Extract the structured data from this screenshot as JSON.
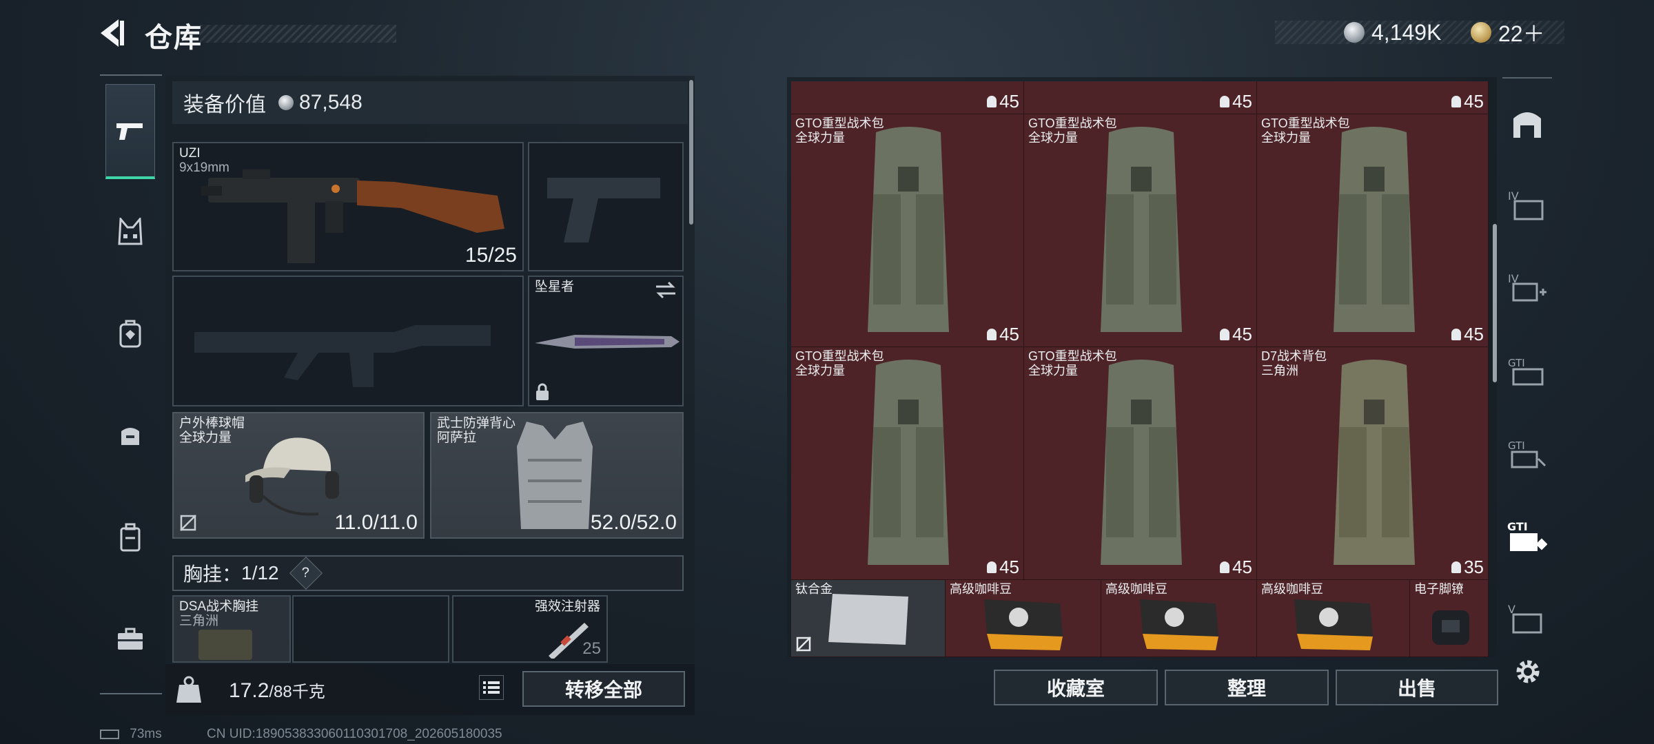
{
  "header": {
    "title": "仓库",
    "currency": [
      {
        "icon": "silver-coin-icon",
        "value": "4,149K"
      },
      {
        "icon": "gold-coin-icon",
        "value": "22＋"
      }
    ]
  },
  "loadout": {
    "value_label": "装备价值",
    "value": "87,548",
    "primary_weapon": {
      "name": "UZI",
      "ammo": "9x19mm",
      "count": "15/25"
    },
    "melee": {
      "name": "坠星者"
    },
    "helmet": {
      "name": "户外棒球帽",
      "brand": "全球力量",
      "durability": "11.0/11.0"
    },
    "armor": {
      "name": "武士防弹背心",
      "brand": "阿萨拉",
      "durability": "52.0/52.0"
    },
    "chest_rig_label": "胸挂：",
    "chest_rig_count": "1/12",
    "help": "?",
    "chest_rig": {
      "name": "DSA战术胸挂",
      "brand": "三角洲"
    },
    "injector": {
      "name": "强效注射器",
      "count": "25"
    },
    "weight": "17.2",
    "weight_max": "/88千克",
    "transfer_all": "转移全部"
  },
  "storage": {
    "top_row_counts": [
      "45",
      "45",
      "45"
    ],
    "backpacks": [
      {
        "name": "GTO重型战术包",
        "brand": "全球力量",
        "count": "45"
      },
      {
        "name": "GTO重型战术包",
        "brand": "全球力量",
        "count": "45"
      },
      {
        "name": "GTO重型战术包",
        "brand": "全球力量",
        "count": "45"
      },
      {
        "name": "GTO重型战术包",
        "brand": "全球力量",
        "count": "45"
      },
      {
        "name": "GTO重型战术包",
        "brand": "全球力量",
        "count": "45"
      },
      {
        "name": "D7战术背包",
        "brand": "三角洲",
        "count": "35"
      }
    ],
    "small_items": [
      {
        "name": "钛合金"
      },
      {
        "name": "高级咖啡豆"
      },
      {
        "name": "高级咖啡豆"
      },
      {
        "name": "高级咖啡豆"
      },
      {
        "name": "电子脚镣"
      }
    ],
    "buttons": {
      "collection": "收藏室",
      "sort": "整理",
      "sell": "出售"
    }
  },
  "right_nav": [
    "home-base-icon",
    "iv-storage-icon",
    "iv-add-icon",
    "gti-storage-icon",
    "gti-storage-2-icon",
    "gti-active-icon",
    "v-storage-icon",
    "settings-icon"
  ],
  "status_bar": {
    "ping": "73ms",
    "uid": "CN UID:1890538330601103017​08_202605180035"
  },
  "colors": {
    "accent": "#3fd5a9",
    "grid_bg": "#4e2327"
  }
}
